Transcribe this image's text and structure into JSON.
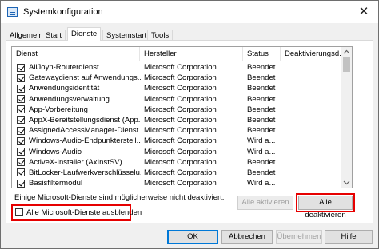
{
  "window": {
    "title": "Systemkonfiguration",
    "close_glyph": "✕"
  },
  "tabs": [
    "Allgemein",
    "Start",
    "Dienste",
    "Systemstart",
    "Tools"
  ],
  "active_tab": "Dienste",
  "columns": [
    "Dienst",
    "Hersteller",
    "Status",
    "Deaktivierungsd..."
  ],
  "services": [
    {
      "name": "AllJoyn-Routerdienst",
      "vendor": "Microsoft Corporation",
      "status": "Beendet",
      "checked": true
    },
    {
      "name": "Gatewaydienst auf Anwendungs...",
      "vendor": "Microsoft Corporation",
      "status": "Beendet",
      "checked": true
    },
    {
      "name": "Anwendungsidentität",
      "vendor": "Microsoft Corporation",
      "status": "Beendet",
      "checked": true
    },
    {
      "name": "Anwendungsverwaltung",
      "vendor": "Microsoft Corporation",
      "status": "Beendet",
      "checked": true
    },
    {
      "name": "App-Vorbereitung",
      "vendor": "Microsoft Corporation",
      "status": "Beendet",
      "checked": true
    },
    {
      "name": "AppX-Bereitstellungsdienst (App...",
      "vendor": "Microsoft Corporation",
      "status": "Beendet",
      "checked": true
    },
    {
      "name": "AssignedAccessManager-Dienst",
      "vendor": "Microsoft Corporation",
      "status": "Beendet",
      "checked": true
    },
    {
      "name": "Windows-Audio-Endpunkterstell...",
      "vendor": "Microsoft Corporation",
      "status": "Wird a...",
      "checked": true
    },
    {
      "name": "Windows-Audio",
      "vendor": "Microsoft Corporation",
      "status": "Wird a...",
      "checked": true
    },
    {
      "name": "ActiveX-Installer (AxInstSV)",
      "vendor": "Microsoft Corporation",
      "status": "Beendet",
      "checked": true
    },
    {
      "name": "BitLocker-Laufwerkverschlüsselu...",
      "vendor": "Microsoft Corporation",
      "status": "Beendet",
      "checked": true
    },
    {
      "name": "Basisfiltermodul",
      "vendor": "Microsoft Corporation",
      "status": "Wird a...",
      "checked": true
    }
  ],
  "note_text": "Einige Microsoft-Dienste sind möglicherweise nicht deaktiviert.",
  "buttons": {
    "enable_all": "Alle aktivieren",
    "disable_all": "Alle deaktivieren",
    "ok": "OK",
    "cancel": "Abbrechen",
    "apply": "Übernehmen",
    "help": "Hilfe"
  },
  "hide_ms_label": "Alle Microsoft-Dienste ausblenden",
  "hide_ms_checked": false,
  "colors": {
    "highlight": "#e60000",
    "accent": "#0078d7"
  }
}
